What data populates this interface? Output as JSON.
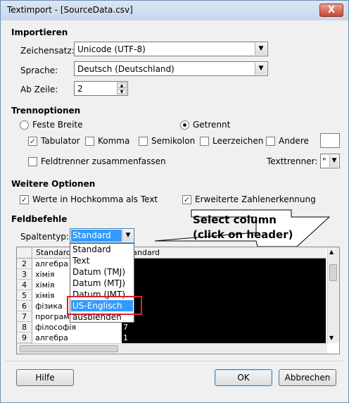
{
  "window": {
    "title": "Textimport - [SourceData.csv]",
    "close_glyph": "X"
  },
  "import": {
    "heading": "Importieren",
    "charset_label": "Zeichensatz:",
    "charset_value": "Unicode (UTF-8)",
    "language_label": "Sprache:",
    "language_value": "Deutsch (Deutschland)",
    "from_row_label": "Ab Zeile:",
    "from_row_value": "2"
  },
  "separator": {
    "heading": "Trennoptionen",
    "fixed_width_label": "Feste Breite",
    "separated_label": "Getrennt",
    "tab_label": "Tabulator",
    "comma_label": "Komma",
    "semicolon_label": "Semikolon",
    "space_label": "Leerzeichen",
    "other_label": "Andere",
    "merge_label": "Feldtrenner zusammenfassen",
    "text_delim_label": "Texttrenner:",
    "text_delim_value": "\""
  },
  "other_options": {
    "heading": "Weitere Optionen",
    "quoted_label": "Werte in Hochkomma als Text",
    "detect_numbers_label": "Erweiterte Zahlenerkennung"
  },
  "fields": {
    "heading": "Feldbefehle",
    "column_type_label": "Spaltentyp:",
    "column_type_value": "Standard",
    "options": [
      "Standard",
      "Text",
      "Datum (TMJ)",
      "Datum (MTJ)",
      "Datum (JMT)",
      "US-Englisch",
      "ausblenden"
    ]
  },
  "callout": {
    "line1": "Select column",
    "line2": "(click on header)"
  },
  "preview": {
    "col1_header": "Standard",
    "col2_header": "Standard",
    "rows": [
      {
        "num": "2",
        "c1": "алгебра",
        "c2": ""
      },
      {
        "num": "3",
        "c1": "хімія",
        "c2": ""
      },
      {
        "num": "4",
        "c1": "хімія",
        "c2": ""
      },
      {
        "num": "5",
        "c1": "хімія",
        "c2": ""
      },
      {
        "num": "6",
        "c1": "фізика",
        "c2": ""
      },
      {
        "num": "7",
        "c1": "програм",
        "c2": ""
      },
      {
        "num": "8",
        "c1": "філософія",
        "c2": "7"
      },
      {
        "num": "9",
        "c1": "алгебра",
        "c2": "1"
      }
    ]
  },
  "buttons": {
    "help": "Hilfe",
    "ok": "OK",
    "cancel": "Abbrechen"
  },
  "colors": {
    "highlight_box": "#e0202a",
    "selection": "#3399ff",
    "dark_column": "#000000"
  }
}
